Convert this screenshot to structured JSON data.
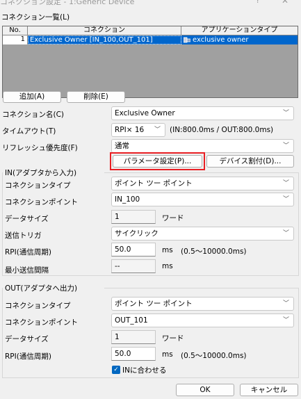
{
  "window": {
    "title": "コネクション設定 - 1:Generic Device",
    "help_glyph": "?",
    "close_glyph": "✕"
  },
  "connection_list": {
    "label": "コネクション一覧(L)",
    "columns": [
      "No.",
      "コネクション",
      "アプリケーションタイプ"
    ],
    "rows": [
      {
        "no": "1",
        "connection": "Exclusive Owner [IN_100,OUT_101]",
        "app_type": "exclusive owner"
      }
    ],
    "selection_color": "#0066cc"
  },
  "buttons": {
    "add": "追加(A)",
    "delete": "削除(E)",
    "param_settings": "パラメータ設定(P)...",
    "device_assign": "デバイス割付(D)...",
    "ok": "OK",
    "cancel": "キャンセル"
  },
  "general": {
    "connection_name_label": "コネクション名(C)",
    "connection_name_value": "Exclusive Owner",
    "timeout_label": "タイムアウト(T)",
    "timeout_value": "RPI× 16",
    "timeout_info": "(IN:800.0ms / OUT:800.0ms)",
    "refresh_label": "リフレッシュ優先度(F)",
    "refresh_value": "通常"
  },
  "in_group": {
    "title": "IN(アダプタから入力)",
    "conn_type_label": "コネクションタイプ",
    "conn_type_value": "ポイント ツー ポイント",
    "conn_point_label": "コネクションポイント",
    "conn_point_value": "IN_100",
    "data_size_label": "データサイズ",
    "data_size_value": "1",
    "data_size_unit": "ワード",
    "trigger_label": "送信トリガ",
    "trigger_value": "サイクリック",
    "rpi_label": "RPI(通信周期)",
    "rpi_value": "50.0",
    "rpi_unit": "ms",
    "rpi_range": "(0.5〜10000.0ms)",
    "min_interval_label": "最小送信間隔",
    "min_interval_value": "--",
    "min_interval_unit": "ms"
  },
  "out_group": {
    "title": "OUT(アダプタへ出力)",
    "conn_type_label": "コネクションタイプ",
    "conn_type_value": "ポイント ツー ポイント",
    "conn_point_label": "コネクションポイント",
    "conn_point_value": "OUT_101",
    "data_size_label": "データサイズ",
    "data_size_value": "1",
    "data_size_unit": "ワード",
    "rpi_label": "RPI(通信周期)",
    "rpi_value": "50.0",
    "rpi_unit": "ms",
    "rpi_range": "(0.5〜10000.0ms)",
    "match_in_label": "INに合わせる",
    "match_in_checked": true
  },
  "icons": {
    "dropdown": "chevron-down-icon",
    "checkbox": "check-icon",
    "app_type": "device-icon"
  },
  "highlight_color": "#e81f24",
  "checkbox_color": "#0067c0"
}
